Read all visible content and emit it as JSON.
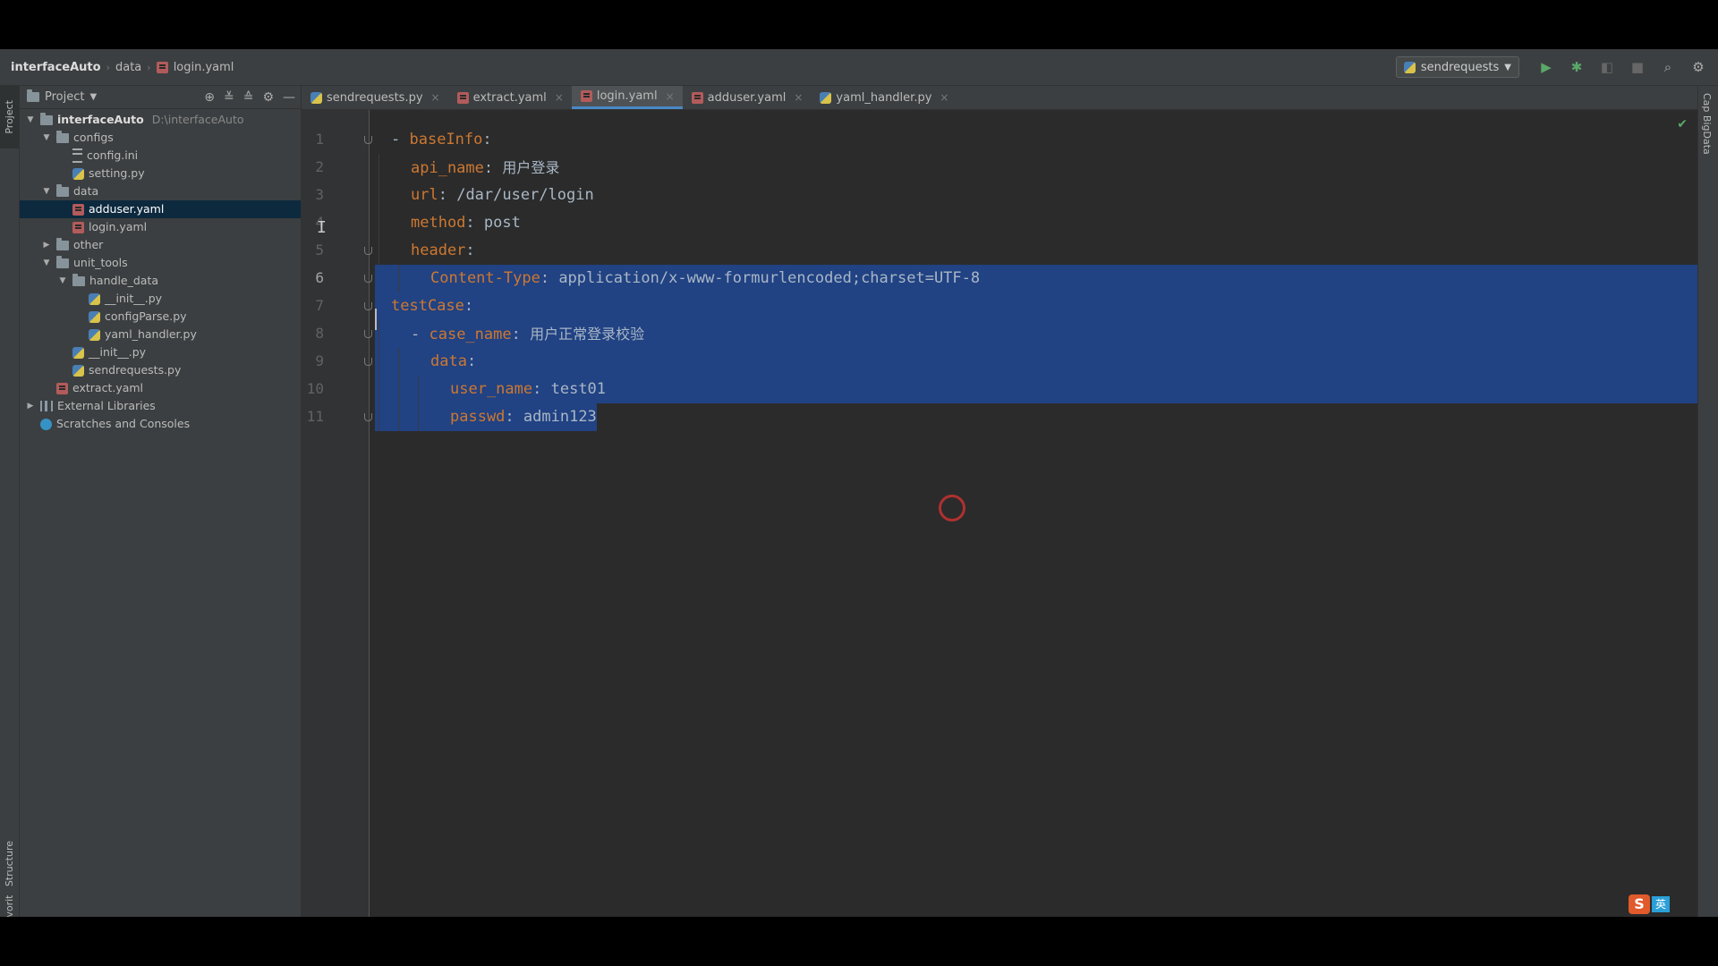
{
  "breadcrumb": [
    "interfaceAuto",
    "data",
    "login.yaml"
  ],
  "run_config": "sendrequests",
  "project_panel": {
    "title": "Project",
    "root_name": "interfaceAuto",
    "root_path": "D:\\interfaceAuto",
    "items": [
      {
        "label": "configs",
        "level": 1,
        "type": "folder",
        "expanded": true
      },
      {
        "label": "config.ini",
        "level": 2,
        "type": "ini"
      },
      {
        "label": "setting.py",
        "level": 2,
        "type": "py"
      },
      {
        "label": "data",
        "level": 1,
        "type": "folder",
        "expanded": true
      },
      {
        "label": "adduser.yaml",
        "level": 2,
        "type": "yaml",
        "selected": true
      },
      {
        "label": "login.yaml",
        "level": 2,
        "type": "yaml"
      },
      {
        "label": "other",
        "level": 1,
        "type": "folder",
        "expanded": false
      },
      {
        "label": "unit_tools",
        "level": 1,
        "type": "folder",
        "expanded": true
      },
      {
        "label": "handle_data",
        "level": 2,
        "type": "folder",
        "expanded": true
      },
      {
        "label": "__init__.py",
        "level": 3,
        "type": "py"
      },
      {
        "label": "configParse.py",
        "level": 3,
        "type": "py"
      },
      {
        "label": "yaml_handler.py",
        "level": 3,
        "type": "py"
      },
      {
        "label": "__init__.py",
        "level": 2,
        "type": "py"
      },
      {
        "label": "sendrequests.py",
        "level": 2,
        "type": "py"
      },
      {
        "label": "extract.yaml",
        "level": 1,
        "type": "yaml"
      },
      {
        "label": "External Libraries",
        "level": 0,
        "type": "lib",
        "expanded": false
      },
      {
        "label": "Scratches and Consoles",
        "level": 0,
        "type": "scratch"
      }
    ]
  },
  "tabs": [
    {
      "label": "sendrequests.py",
      "type": "py",
      "active": false
    },
    {
      "label": "extract.yaml",
      "type": "yaml",
      "active": false
    },
    {
      "label": "login.yaml",
      "type": "yaml",
      "active": true
    },
    {
      "label": "adduser.yaml",
      "type": "yaml",
      "active": false
    },
    {
      "label": "yaml_handler.py",
      "type": "py",
      "active": false
    }
  ],
  "editor": {
    "current_line": 6,
    "lines": [
      {
        "n": "1",
        "indent": 0,
        "prefix": "- ",
        "key": "baseInfo",
        "value": ""
      },
      {
        "n": "2",
        "indent": 1,
        "prefix": "",
        "key": "api_name",
        "value": "用户登录"
      },
      {
        "n": "3",
        "indent": 1,
        "prefix": "",
        "key": "url",
        "value": "/dar/user/login"
      },
      {
        "n": "4",
        "indent": 1,
        "prefix": "",
        "key": "method",
        "value": "post"
      },
      {
        "n": "5",
        "indent": 1,
        "prefix": "",
        "key": "header",
        "value": ""
      },
      {
        "n": "6",
        "indent": 2,
        "prefix": "",
        "key": "Content-Type",
        "value": "application/x-www-formurlencoded;charset=UTF-8"
      },
      {
        "n": "7",
        "indent": 0,
        "prefix": "",
        "key": "testCase",
        "value": ""
      },
      {
        "n": "8",
        "indent": 1,
        "prefix": "- ",
        "key": "case_name",
        "value": "用户正常登录校验"
      },
      {
        "n": "9",
        "indent": 2,
        "prefix": "",
        "key": "data",
        "value": ""
      },
      {
        "n": "10",
        "indent": 3,
        "prefix": "",
        "key": "user_name",
        "value": "test01"
      },
      {
        "n": "11",
        "indent": 3,
        "prefix": "",
        "key": "passwd",
        "value": "admin123"
      }
    ]
  },
  "stripes": {
    "left_top": "Project",
    "left_bottom_1": "Structure",
    "left_bottom_2": "Favorites",
    "right": "Cap BigData"
  },
  "ime": {
    "s": "S",
    "lang": "英"
  },
  "colors": {
    "key": "#cc7832",
    "value": "#a9b7c6",
    "selection": "#214283",
    "accent": "#4a88c7"
  }
}
